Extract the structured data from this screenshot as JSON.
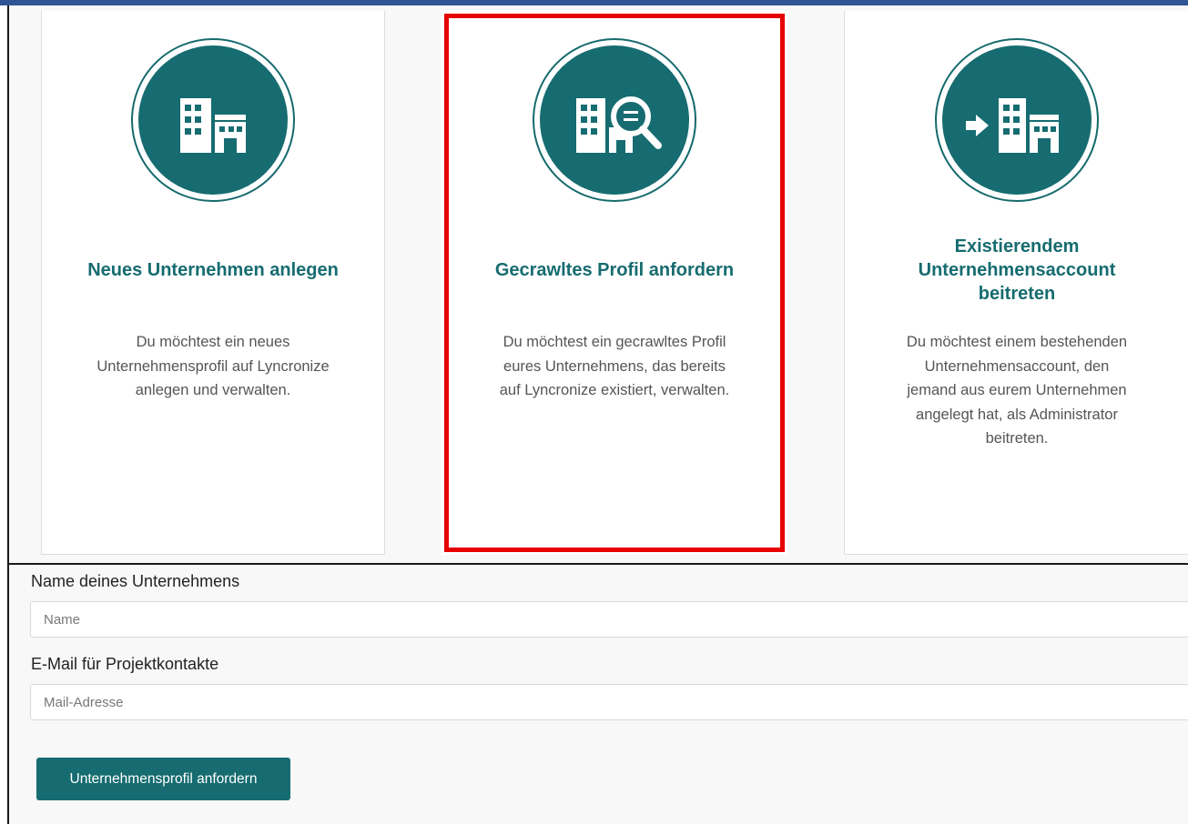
{
  "cards": [
    {
      "icon": "buildings-icon",
      "title": "Neues Unternehmen anlegen",
      "description": "Du möchtest ein neues Unternehmensprofil auf Lyncronize anlegen und verwalten."
    },
    {
      "icon": "building-search-icon",
      "title": "Gecrawltes Profil anfordern",
      "description": "Du möchtest ein gecrawltes Profil eures Unternehmens, das bereits auf Lyncronize existiert, verwalten."
    },
    {
      "icon": "building-enter-icon",
      "title": "Existierendem Unternehmensaccount beitreten",
      "description": "Du möchtest einem bestehenden Unternehmensaccount, den jemand aus eurem Unternehmen angelegt hat, als Administrator beitreten."
    }
  ],
  "form": {
    "name_label": "Name deines Unternehmens",
    "name_placeholder": "Name",
    "email_label": "E-Mail für Projektkontakte",
    "email_placeholder": "Mail-Adresse",
    "submit_label": "Unternehmensprofil anfordern"
  },
  "colors": {
    "accent": "#166c70",
    "selection": "#e60000"
  }
}
